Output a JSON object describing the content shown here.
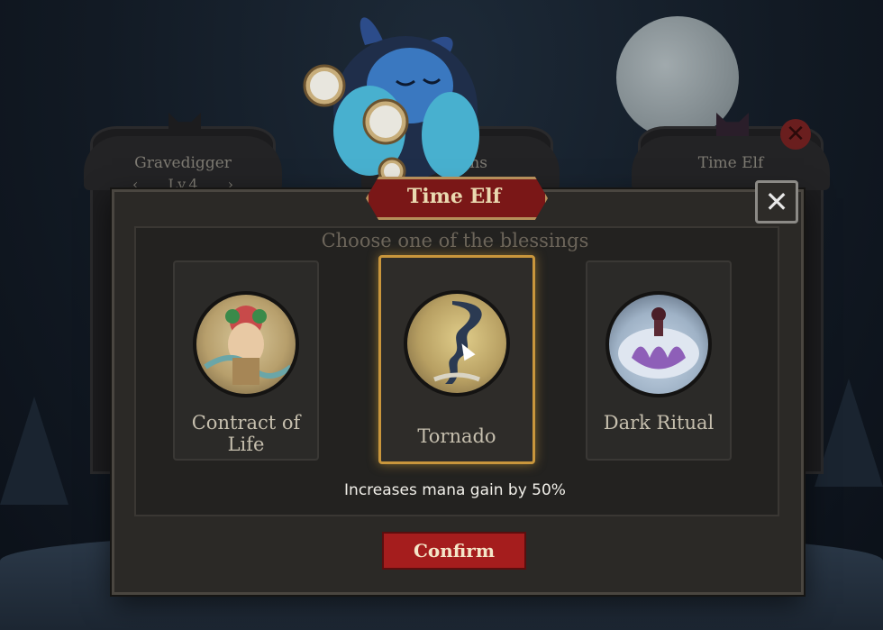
{
  "background": {
    "left_plate": {
      "name": "Gravedigger",
      "level": "Lv.4"
    },
    "middle_plate": {
      "name": "ns"
    },
    "right_plate": {
      "name": "Time Elf"
    }
  },
  "dialog": {
    "title": "Time Elf",
    "close_label": "✕",
    "subtitle": "Choose one of the blessings",
    "blessings": [
      {
        "label": "Contract of Life",
        "selected": false,
        "icon": "contract-of-life-icon"
      },
      {
        "label": "Tornado",
        "selected": true,
        "icon": "tornado-icon"
      },
      {
        "label": "Dark Ritual",
        "selected": false,
        "icon": "dark-ritual-icon"
      }
    ],
    "description": "Increases mana gain by 50%",
    "confirm_label": "Confirm"
  },
  "colors": {
    "accent_red": "#a51d1d",
    "selected_gold": "#c9963c"
  }
}
